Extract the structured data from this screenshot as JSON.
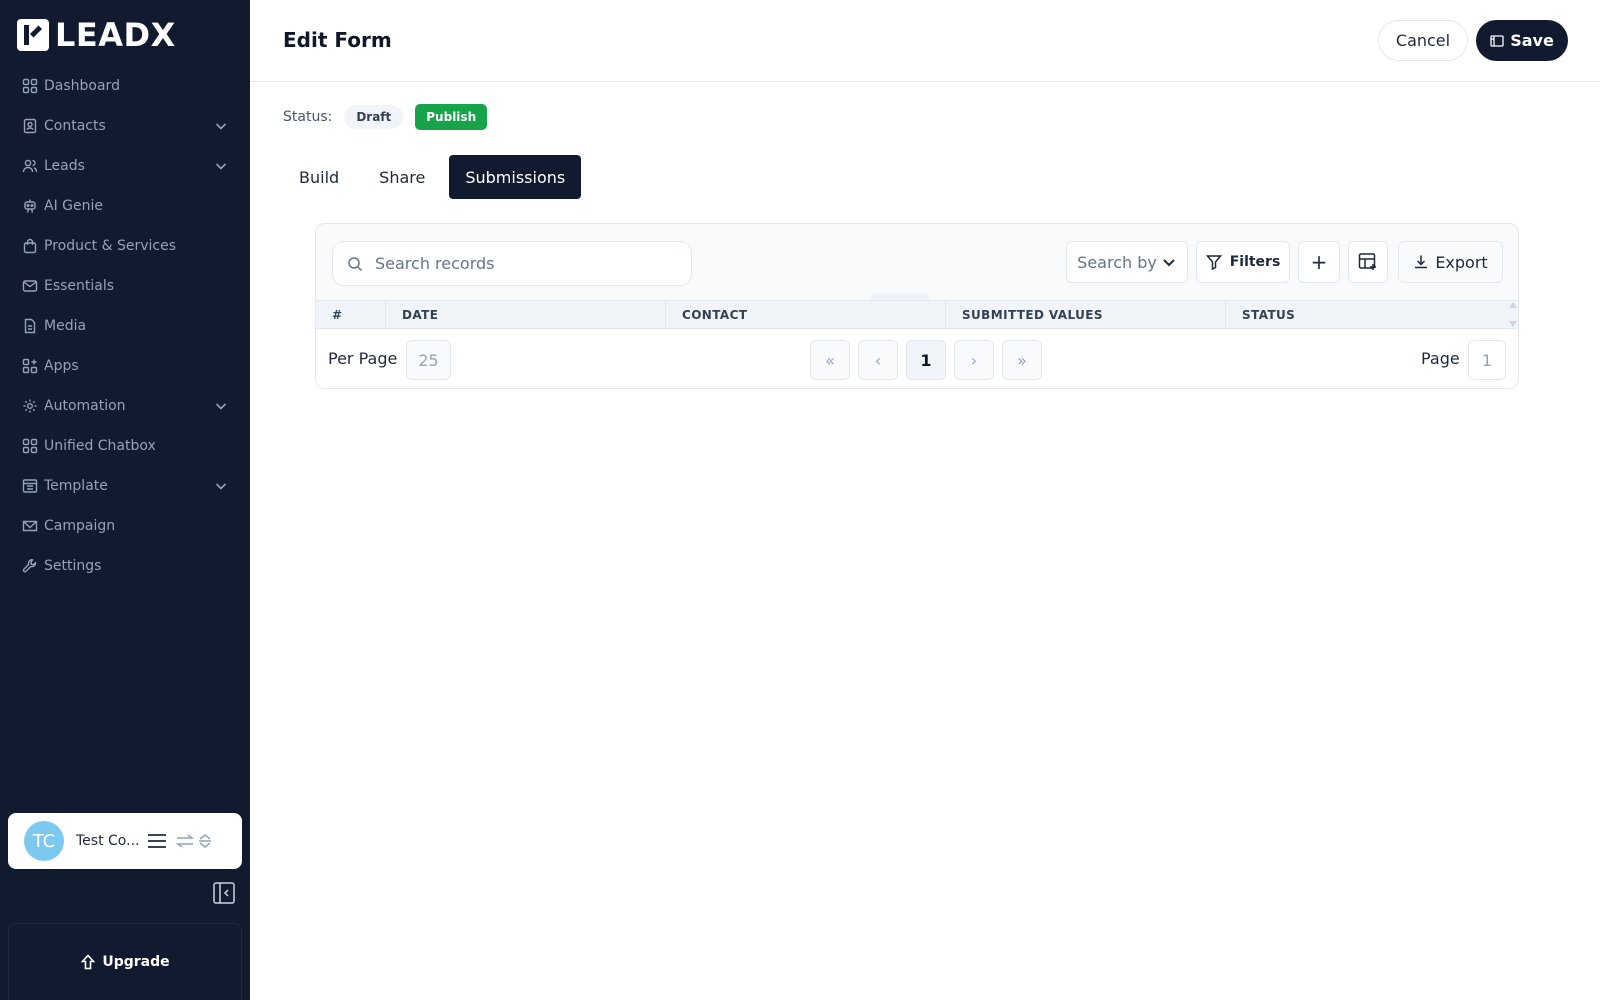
{
  "brand": {
    "name": "LEADX"
  },
  "sidebar": {
    "items": [
      {
        "label": "Dashboard",
        "icon": "grid-icon",
        "expandable": false
      },
      {
        "label": "Contacts",
        "icon": "contact-book-icon",
        "expandable": true
      },
      {
        "label": "Leads",
        "icon": "users-icon",
        "expandable": true
      },
      {
        "label": "AI Genie",
        "icon": "robot-icon",
        "expandable": false
      },
      {
        "label": "Product & Services",
        "icon": "shopping-bag-icon",
        "expandable": false
      },
      {
        "label": "Essentials",
        "icon": "mail-icon",
        "expandable": false
      },
      {
        "label": "Media",
        "icon": "file-icon",
        "expandable": false
      },
      {
        "label": "Apps",
        "icon": "apps-grid-icon",
        "expandable": false
      },
      {
        "label": "Automation",
        "icon": "gear-icon",
        "expandable": true
      },
      {
        "label": "Unified Chatbox",
        "icon": "grid-icon",
        "expandable": false
      },
      {
        "label": "Template",
        "icon": "template-icon",
        "expandable": true
      },
      {
        "label": "Campaign",
        "icon": "campaign-mail-icon",
        "expandable": false
      },
      {
        "label": "Settings",
        "icon": "wrench-icon",
        "expandable": false
      }
    ],
    "user": {
      "initials": "TC",
      "name": "Test Co..."
    },
    "upgrade_label": "Upgrade"
  },
  "header": {
    "title": "Edit Form",
    "cancel_label": "Cancel",
    "save_label": "Save"
  },
  "status": {
    "label": "Status:",
    "draft_label": "Draft",
    "publish_label": "Publish"
  },
  "tabs": [
    {
      "label": "Build",
      "active": false
    },
    {
      "label": "Share",
      "active": false
    },
    {
      "label": "Submissions",
      "active": true
    }
  ],
  "table": {
    "search_placeholder": "Search records",
    "search_by_label": "Search by",
    "filters_label": "Filters",
    "add_label": "+",
    "export_label": "Export",
    "columns": [
      "#",
      "DATE",
      "CONTACT",
      "SUBMITTED VALUES",
      "STATUS"
    ],
    "rows": []
  },
  "pagination": {
    "per_page_label": "Per Page",
    "per_page_value": "25",
    "first_label": "«",
    "prev_label": "‹",
    "current_page": "1",
    "next_label": "›",
    "last_label": "»",
    "page_label": "Page",
    "page_value": "1"
  },
  "colors": {
    "sidebar_bg": "#111a2e",
    "primary": "#111a2e",
    "publish_green": "#16a34a",
    "avatar": "#7dc8ee"
  }
}
